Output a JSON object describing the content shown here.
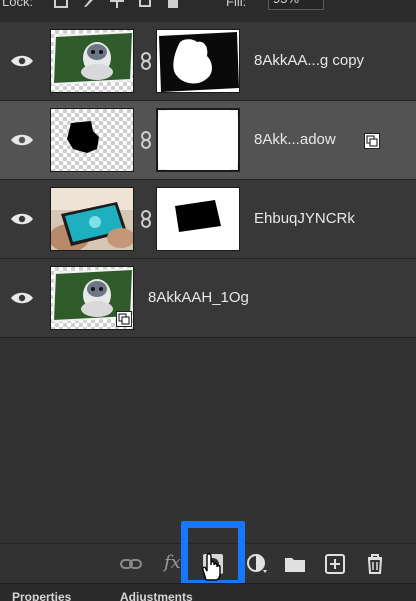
{
  "header": {
    "lock_label": "Lock:",
    "fill_label": "Fill:",
    "fill_value": "95%"
  },
  "layers": [
    {
      "name": "8AkkAA...g copy",
      "visible": true,
      "selected": false,
      "has_mask": true,
      "linked": true
    },
    {
      "name": "8Akk...adow",
      "visible": true,
      "selected": true,
      "has_mask": true,
      "linked": true,
      "smart_object": true
    },
    {
      "name": "EhbuqJYNCRk",
      "visible": true,
      "selected": false,
      "has_mask": true,
      "linked": true
    },
    {
      "name": "8AkkAAH_1Og",
      "visible": true,
      "selected": false,
      "has_mask": false,
      "linked": false,
      "smart_object": true
    }
  ],
  "toolbar": {
    "fx_label": "fx",
    "tools": [
      "link-icon",
      "fx-icon",
      "add-mask-icon",
      "adjustment-icon",
      "folder-icon",
      "new-layer-icon",
      "trash-icon"
    ],
    "highlight_color": "#1778ff"
  },
  "bottom_tabs": {
    "tab1": "Properties",
    "tab2": "Adjustments"
  }
}
